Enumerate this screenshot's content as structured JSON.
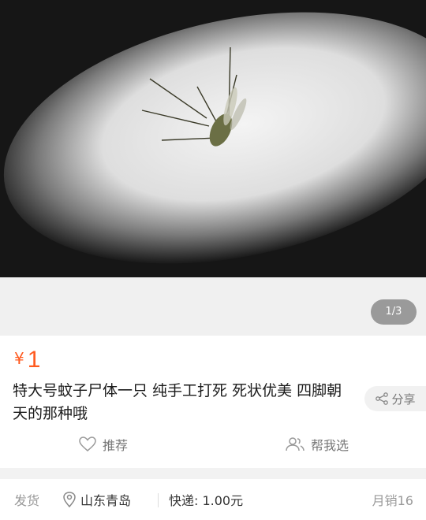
{
  "gallery": {
    "pager": "1/3"
  },
  "product": {
    "currency": "¥",
    "price": "1",
    "title": "特大号蚊子尸体一只 纯手工打死 死状优美 四脚朝天的那种哦"
  },
  "actions": {
    "share_label": "分享",
    "recommend_label": "推荐",
    "help_choose_label": "帮我选"
  },
  "footer": {
    "ship_label": "发货",
    "location": "山东青岛",
    "express": "快递: 1.00元",
    "monthly_sales": "月销16"
  },
  "colors": {
    "price": "#ff5a1f",
    "background": "#f2f2f2"
  }
}
